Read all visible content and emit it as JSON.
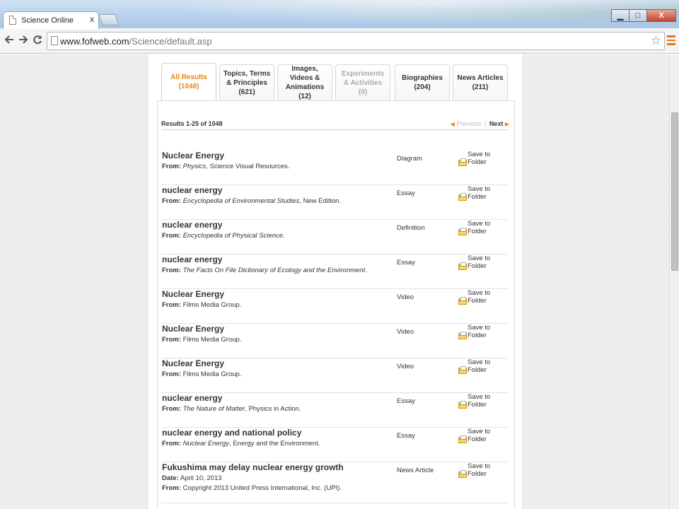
{
  "browser": {
    "tab_title": "Science Online",
    "tab_close": "x",
    "url_host": "www.fofweb.com",
    "url_path": "/Science/default.asp",
    "window_controls": {
      "minimize": "▁",
      "maximize": "□",
      "close": "X"
    }
  },
  "result_tabs": [
    {
      "label": "All Results (1048)",
      "state": "active"
    },
    {
      "label": "Topics, Terms & Principles (621)",
      "state": "normal"
    },
    {
      "label": "Images, Videos & Animations (12)",
      "state": "normal"
    },
    {
      "label": "Experiments & Activities (0)",
      "state": "disabled"
    },
    {
      "label": "Biographies (204)",
      "state": "normal"
    },
    {
      "label": "News Articles (211)",
      "state": "normal"
    }
  ],
  "results_header": {
    "count_text": "Results 1-25  of 1048",
    "previous": "Previous",
    "separator": "|",
    "next": "Next"
  },
  "save_label": "Save to Folder",
  "results": [
    {
      "title": "Nuclear Energy",
      "from_label": "From:",
      "from_italic": "Physics",
      "from_rest": ", Science Visual Resources.",
      "type": "Diagram"
    },
    {
      "title": "nuclear energy",
      "from_label": "From:",
      "from_italic": "Encyclopedia of Environmental Studies",
      "from_rest": ", New Edition.",
      "type": "Essay"
    },
    {
      "title": "nuclear energy",
      "from_label": "From:",
      "from_italic": "Encyclopedia of Physical Science",
      "from_rest": ".",
      "type": "Definition"
    },
    {
      "title": "nuclear energy",
      "from_label": "From:",
      "from_italic": "The Facts On File Dictionary of Ecology and the Environment",
      "from_rest": ".",
      "type": "Essay"
    },
    {
      "title": "Nuclear Energy",
      "from_label": "From:",
      "from_italic": "",
      "from_rest": "Films Media Group.",
      "type": "Video"
    },
    {
      "title": "Nuclear Energy",
      "from_label": "From:",
      "from_italic": "",
      "from_rest": "Films Media Group.",
      "type": "Video"
    },
    {
      "title": "Nuclear Energy",
      "from_label": "From:",
      "from_italic": "",
      "from_rest": "Films Media Group.",
      "type": "Video"
    },
    {
      "title": "nuclear energy",
      "from_label": "From:",
      "from_italic": "The Nature of Matter",
      "from_rest": ", Physics in Action.",
      "type": "Essay"
    },
    {
      "title": "nuclear energy and national policy",
      "from_label": "From:",
      "from_italic": "Nuclear Energy",
      "from_rest": ", Energy and the Environment.",
      "type": "Essay"
    },
    {
      "title": "Fukushima may delay nuclear energy growth",
      "date_label": "Date:",
      "date": "April 10, 2013",
      "from_label": "From:",
      "from_italic": "",
      "from_rest": "Copyright 2013 United Press International, Inc. (UPI).",
      "type": "News Article"
    }
  ]
}
